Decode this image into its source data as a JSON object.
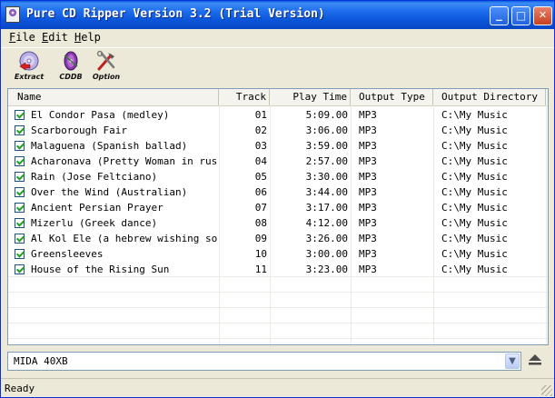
{
  "window": {
    "title": "Pure CD Ripper Version 3.2 (Trial Version)"
  },
  "title_buttons": {
    "minimize": "_",
    "maximize": "□",
    "close": "✕"
  },
  "menu": [
    {
      "key": "F",
      "rest": "ile"
    },
    {
      "key": "E",
      "rest": "dit"
    },
    {
      "key": "H",
      "rest": "elp"
    }
  ],
  "toolbar": [
    {
      "label": "Extract",
      "icon": "extract-icon"
    },
    {
      "label": "CDDB",
      "icon": "cddb-icon"
    },
    {
      "label": "Option",
      "icon": "option-icon"
    }
  ],
  "columns": [
    "Name",
    "Track",
    "Play Time",
    "Output Type",
    "Output Directory"
  ],
  "tracks": [
    {
      "name": "El Condor Pasa (medley)",
      "track": "01",
      "time": "5:09.00",
      "type": "MP3",
      "dir": "C:\\My Music",
      "checked": true
    },
    {
      "name": "Scarborough Fair",
      "track": "02",
      "time": "3:06.00",
      "type": "MP3",
      "dir": "C:\\My Music",
      "checked": true
    },
    {
      "name": "Malaguena (Spanish ballad)",
      "track": "03",
      "time": "3:59.00",
      "type": "MP3",
      "dir": "C:\\My Music",
      "checked": true
    },
    {
      "name": "Acharonava (Pretty Woman in rus...",
      "track": "04",
      "time": "2:57.00",
      "type": "MP3",
      "dir": "C:\\My Music",
      "checked": true
    },
    {
      "name": "Rain (Jose Feltciano)",
      "track": "05",
      "time": "3:30.00",
      "type": "MP3",
      "dir": "C:\\My Music",
      "checked": true
    },
    {
      "name": "Over the Wind (Australian)",
      "track": "06",
      "time": "3:44.00",
      "type": "MP3",
      "dir": "C:\\My Music",
      "checked": true
    },
    {
      "name": "Ancient Persian Prayer",
      "track": "07",
      "time": "3:17.00",
      "type": "MP3",
      "dir": "C:\\My Music",
      "checked": true
    },
    {
      "name": "Mizerlu (Greek dance)",
      "track": "08",
      "time": "4:12.00",
      "type": "MP3",
      "dir": "C:\\My Music",
      "checked": true
    },
    {
      "name": "Al Kol Ele (a hebrew wishing song)",
      "track": "09",
      "time": "3:26.00",
      "type": "MP3",
      "dir": "C:\\My Music",
      "checked": true
    },
    {
      "name": "Greensleeves",
      "track": "10",
      "time": "3:00.00",
      "type": "MP3",
      "dir": "C:\\My Music",
      "checked": true
    },
    {
      "name": "House of the Rising Sun",
      "track": "11",
      "time": "3:23.00",
      "type": "MP3",
      "dir": "C:\\My Music",
      "checked": true
    }
  ],
  "drive": {
    "selected": "MIDA   40XB",
    "eject_icon": "eject-icon"
  },
  "status": {
    "text": "Ready"
  },
  "colors": {
    "titlebar": "#0a54d8",
    "check": "#21a121",
    "face": "#ece9d8"
  }
}
